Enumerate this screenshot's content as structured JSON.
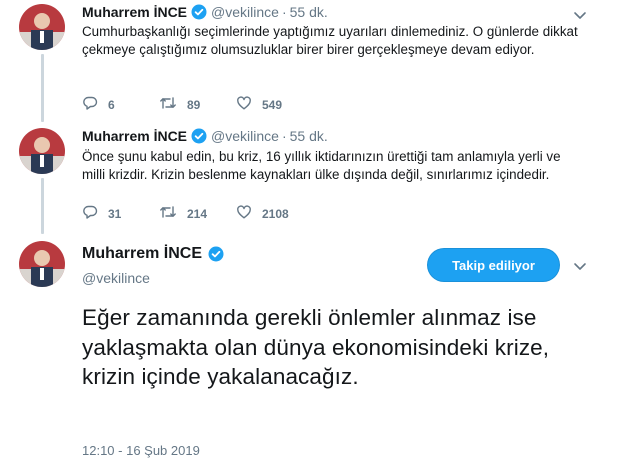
{
  "author": {
    "name": "Muharrem İNCE",
    "handle": "@vekilince"
  },
  "colors": {
    "accent": "#1da1f2",
    "muted": "#657786",
    "thread_line": "#ccd6dd",
    "text": "#14171a"
  },
  "tweets": [
    {
      "name": "Muharrem İNCE",
      "handle": "@vekilince",
      "separator": "·",
      "time": "55 dk.",
      "text": "Cumhurbaşkanlığı seçimlerinde yaptığımız uyarıları dinlemediniz. O günlerde dikkat çekmeye çalıştığımız olumsuzluklar birer birer gerçekleşmeye devam ediyor.",
      "replies": "6",
      "retweets": "89",
      "likes": "549"
    },
    {
      "name": "Muharrem İNCE",
      "handle": "@vekilince",
      "separator": "·",
      "time": "55 dk.",
      "text": "Önce şunu kabul edin, bu kriz, 16 yıllık iktidarınızın ürettiği tam anlamıyla yerli ve milli krizdir. Krizin beslenme kaynakları ülke dışında değil, sınırlarımız içindedir.",
      "replies": "31",
      "retweets": "214",
      "likes": "2108"
    }
  ],
  "focused_tweet": {
    "name": "Muharrem İNCE",
    "handle": "@vekilince",
    "follow_label": "Takip ediliyor",
    "text": "Eğer zamanında gerekli önlemler alınmaz ise yaklaşmakta olan dünya ekonomisindeki krize, krizin içinde yakalanacağız.",
    "timestamp": "12:10 - 16 Şub 2019"
  },
  "icons": {
    "verified": "verified-badge-icon",
    "caret": "chevron-down-icon",
    "reply": "reply-icon",
    "retweet": "retweet-icon",
    "like": "heart-icon"
  }
}
